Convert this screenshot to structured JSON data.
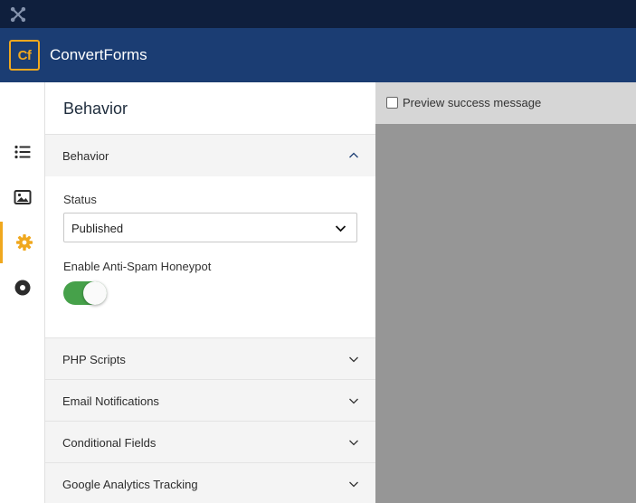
{
  "topbar": {
    "icon": "joomla-icon"
  },
  "header": {
    "logo_text": "Cf",
    "brand": "ConvertForms",
    "accent": "#f0a81e",
    "bg": "#1b3d73"
  },
  "sidebar": {
    "items": [
      {
        "icon": "list-icon",
        "active": false
      },
      {
        "icon": "image-icon",
        "active": false
      },
      {
        "icon": "gear-icon",
        "active": true
      },
      {
        "icon": "circle-dot-icon",
        "active": false
      }
    ]
  },
  "panel": {
    "title": "Behavior",
    "open_section": {
      "label": "Behavior",
      "status_label": "Status",
      "status_value": "Published",
      "honeypot_label": "Enable Anti-Spam Honeypot",
      "honeypot_on": true
    },
    "sections": [
      {
        "label": "PHP Scripts"
      },
      {
        "label": "Email Notifications"
      },
      {
        "label": "Conditional Fields"
      },
      {
        "label": "Google Analytics Tracking"
      }
    ]
  },
  "preview": {
    "checkbox_label": "Preview success message",
    "checked": false
  }
}
